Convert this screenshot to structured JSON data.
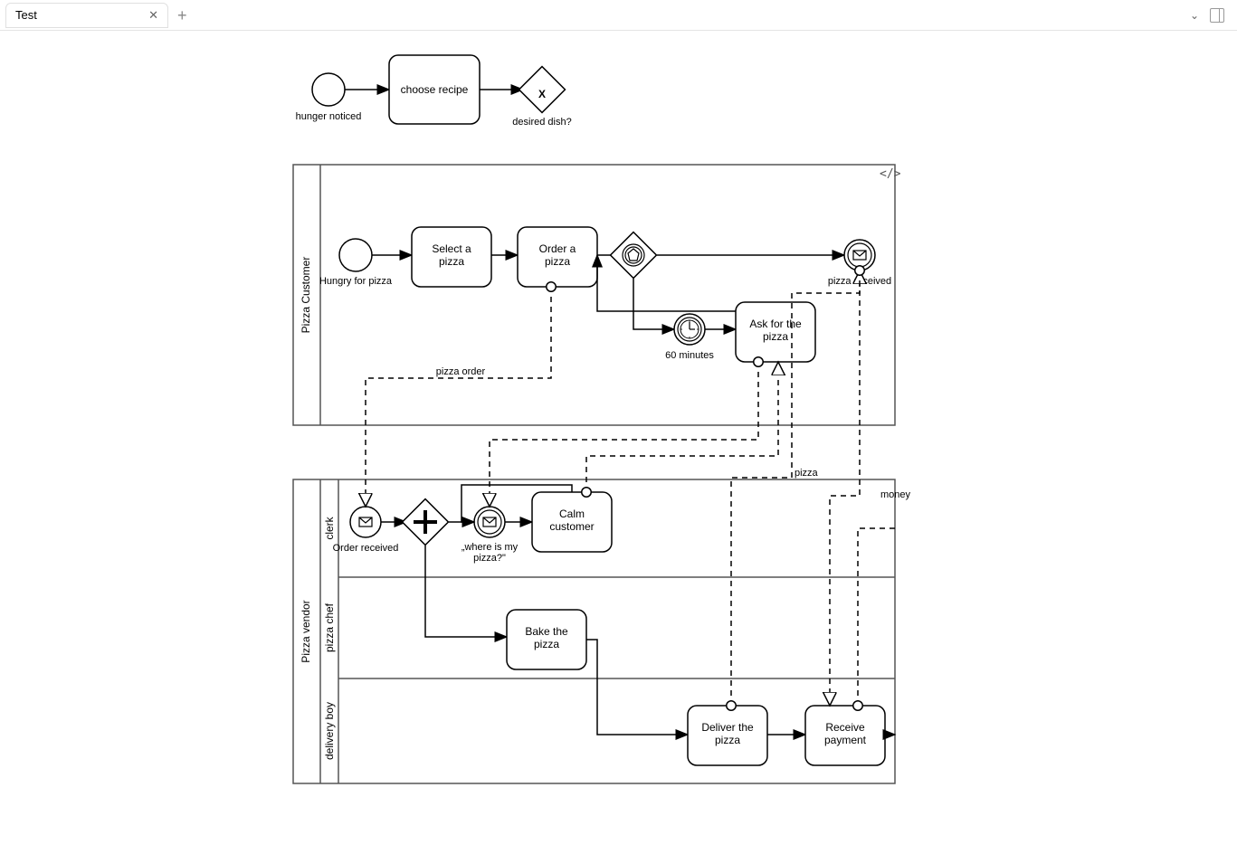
{
  "header": {
    "tab_label": "Test"
  },
  "top_process": {
    "start_label": "hunger noticed",
    "task1": "choose recipe",
    "gateway_label": "desired dish?"
  },
  "pool1": {
    "name": "Pizza Customer",
    "start_label": "Hungry for pizza",
    "task_select": "Select a\npizza",
    "task_order": "Order a\npizza",
    "timer_label": "60 minutes",
    "task_ask": "Ask for the\npizza",
    "end_label": "pizza received",
    "msg_order": "pizza order"
  },
  "pool2": {
    "name": "Pizza vendor",
    "lanes": [
      "clerk",
      "pizza chef",
      "delivery boy"
    ],
    "start_label": "Order received",
    "msg_event_label": "„where is my\npizza?\"",
    "task_calm": "Calm\ncustomer",
    "task_bake": "Bake the\npizza",
    "task_deliver": "Deliver the\npizza",
    "task_receive": "Receive\npayment",
    "msg_pizza": "pizza",
    "msg_money": "money"
  }
}
